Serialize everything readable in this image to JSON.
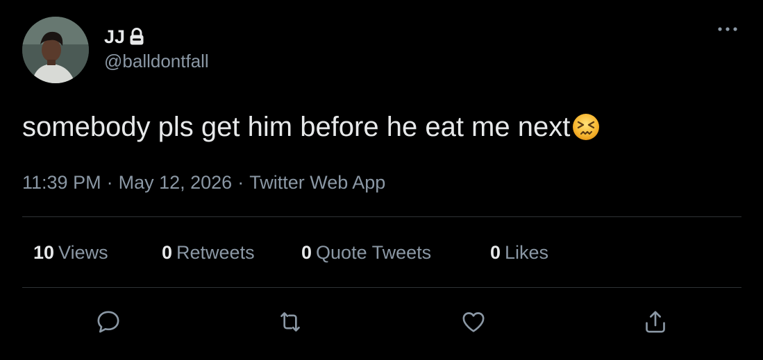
{
  "author": {
    "display_name": "JJ",
    "handle": "@balldontfall",
    "protected": true
  },
  "tweet": {
    "text": "somebody pls get him before he eat me next",
    "emoji": "persevering-face",
    "time": "11:39 PM",
    "date": "May 12, 2026",
    "source": "Twitter Web App",
    "separator": "·"
  },
  "stats": {
    "views": {
      "count": "10",
      "label": "Views"
    },
    "retweets": {
      "count": "0",
      "label": "Retweets"
    },
    "quotes": {
      "count": "0",
      "label": "Quote Tweets"
    },
    "likes": {
      "count": "0",
      "label": "Likes"
    }
  },
  "actions": [
    "reply-icon",
    "retweet-icon",
    "like-icon",
    "share-icon"
  ],
  "colors": {
    "background": "#000000",
    "primary_text": "#e7e9ea",
    "secondary_text": "#8b98a5",
    "divider": "#2f3336"
  }
}
